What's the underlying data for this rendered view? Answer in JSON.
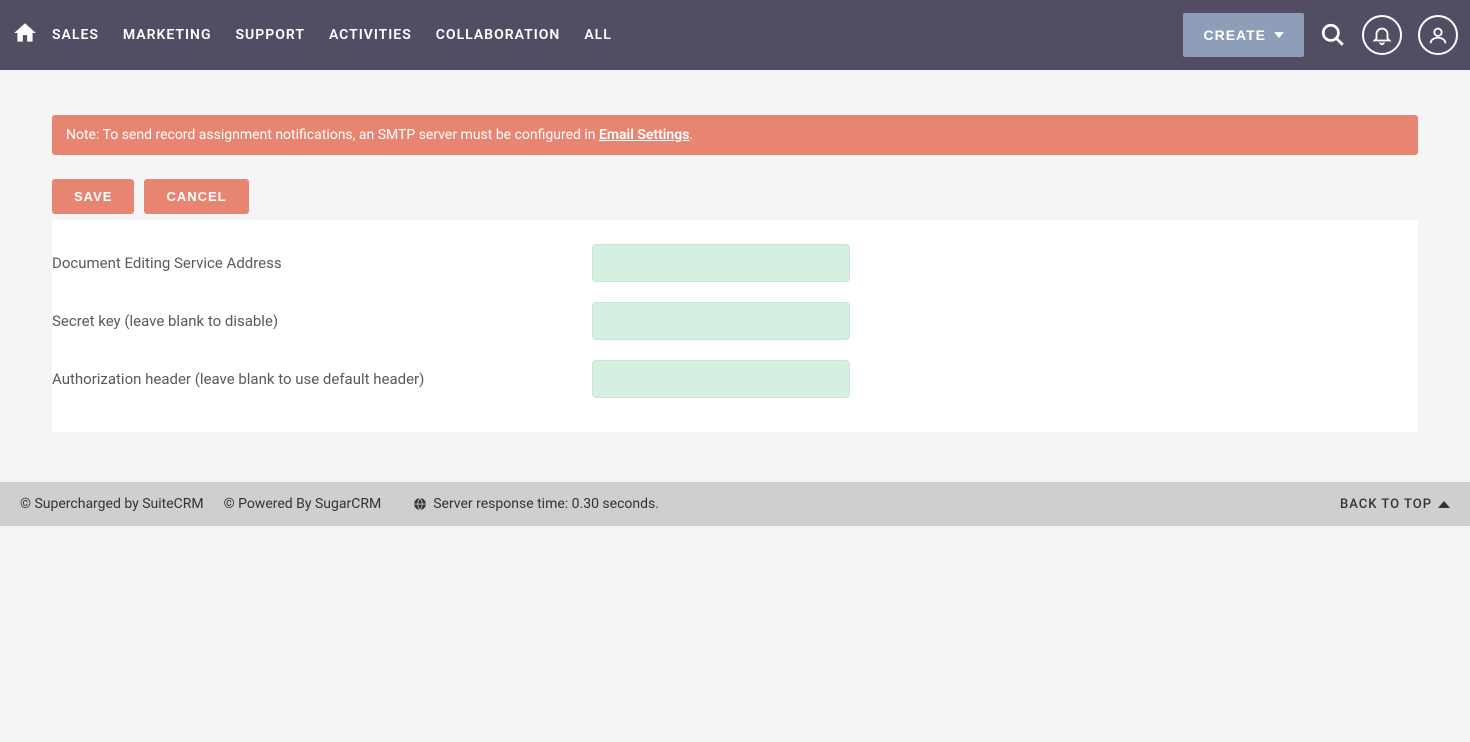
{
  "nav": {
    "items": [
      "SALES",
      "MARKETING",
      "SUPPORT",
      "ACTIVITIES",
      "COLLABORATION",
      "ALL"
    ],
    "create_label": "CREATE"
  },
  "alert": {
    "prefix": "Note: To send record assignment notifications, an SMTP server must be configured in ",
    "link_text": "Email Settings",
    "suffix": "."
  },
  "actions": {
    "save": "SAVE",
    "cancel": "CANCEL"
  },
  "form": {
    "fields": [
      {
        "label": "Document Editing Service Address",
        "value": ""
      },
      {
        "label": "Secret key (leave blank to disable)",
        "value": ""
      },
      {
        "label": "Authorization header (leave blank to use default header)",
        "value": ""
      }
    ]
  },
  "footer": {
    "supercharged": "© Supercharged by SuiteCRM",
    "powered": "© Powered By SugarCRM",
    "response": "Server response time: 0.30 seconds.",
    "back_to_top": "BACK TO TOP"
  }
}
